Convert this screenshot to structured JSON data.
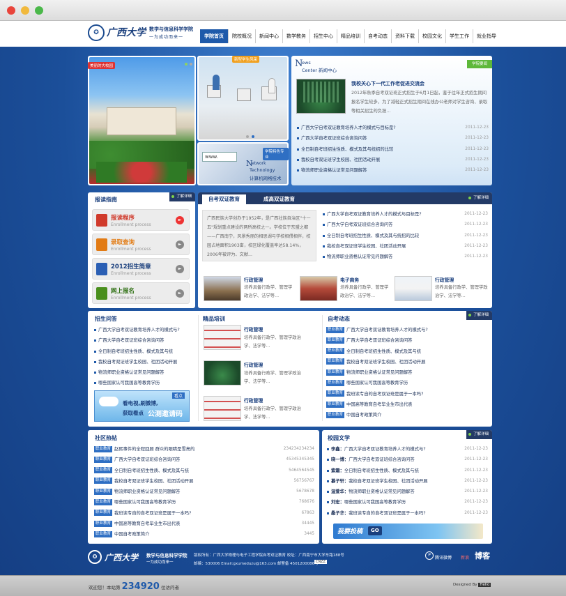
{
  "header": {
    "school_name": "广西大学",
    "school_dept": "数学与信息科学学院",
    "slogan": "一为成功而来一"
  },
  "nav": {
    "items": [
      "学院首页",
      "院校概况",
      "新闻中心",
      "数学教务",
      "招生中心",
      "精品培训",
      "自考动态",
      "资料下载",
      "校园文化",
      "学生工作",
      "就业指导"
    ]
  },
  "banner": {
    "photo_tag": "美丽的大校园",
    "class_tag": "新型学生风采",
    "tech_tag": "学院特色专业",
    "tech_caption_1": "etwork",
    "tech_caption_2": "Technology",
    "tech_caption_3": "计算机网络技术",
    "www_label": "www."
  },
  "news": {
    "title_en_1": "ews",
    "title_en_2": "Center 新闻中心",
    "badge": "学院要闻",
    "feature_title": "我校关心下一代工作老促进交流会",
    "feature_text": "2012年秋季自考双证班正式招生于6月1日起，鉴于往年正式招生期间报名学生较多，为了减轻正式招生期间在线办公老师对学生咨询、录取等相关招生的负担...",
    "items": [
      {
        "text": "广西大学自考双证教育培养人才的模式与目标是?",
        "date": "2011-12-23"
      },
      {
        "text": "广西大学自考双证班综合咨询问答",
        "date": "2011-12-23"
      },
      {
        "text": "全日制自考班招生性质、模式及其与统招的比较",
        "date": "2011-12-23"
      },
      {
        "text": "我校自考双证班学生校园、社团活动开展",
        "date": "2011-12-23"
      },
      {
        "text": "物流师职业资格认证常见问题解答",
        "date": "2011-12-23"
      }
    ]
  },
  "guide": {
    "title": "报读指南",
    "more": "了解详细",
    "entries": [
      {
        "label": "报读程序",
        "sub": "Enrollment process",
        "color": "#d03a2b"
      },
      {
        "label": "录取查询",
        "sub": "Enrollment process",
        "color": "#e27b14"
      },
      {
        "label": "2012招生简章",
        "sub": "Enrollment process",
        "color": "#2b5fb4"
      },
      {
        "label": "网上报名",
        "sub": "Enrollment process",
        "color": "#4a8f1d"
      }
    ]
  },
  "edu": {
    "tab_active": "自考双证教育",
    "tab_other": "成高双证教育",
    "more": "了解详细",
    "intro": "广西民族大学创办于1952年，是广西壮族自治区\"十一五\"规划重点建设的两所高校之一。学校位于东盟之都——广西南宁，风景秀丽的相思湖与学校相偎相伴，校园占地面积1903亩，校区绿化覆盖率达58.14%，2006年被评为、文献...",
    "items": [
      {
        "text": "广西大学自考双证教育培养人才的模式与目标是?",
        "date": "2011-12-23"
      },
      {
        "text": "广西大学自考双证班综合咨询问答",
        "date": "2011-12-23"
      },
      {
        "text": "全日制自考班招生性质、模式及其与统招的比较",
        "date": "2011-12-23"
      },
      {
        "text": "我校自考双证班学生校园、社团活动开展",
        "date": "2011-12-23"
      },
      {
        "text": "物流师职业资格认证常见问题解答",
        "date": "2011-12-23"
      }
    ],
    "courses": [
      {
        "title": "行政管理",
        "desc": "培养具备行政学、管理学政治学、法学等..."
      },
      {
        "title": "电子商务",
        "desc": "培养具备行政学、管理学政治学、法学等..."
      },
      {
        "title": "行政管理",
        "desc": "培养具备行政学、管理学政治学、法学等..."
      }
    ]
  },
  "qa": {
    "title": "招生问答",
    "items": [
      "广西大学自考双证教育培养人才的模式与?",
      "广西大学自考双证班综合咨询问答",
      "全日制自考班招生性质、模式及其与统",
      "我校自考双证班学生校园、社团活动开展",
      "物流师职业资格认证常见问题解答",
      "哪些国家认可我国高等教育学历"
    ],
    "ad_line1": "看电视,刷微博,",
    "ad_line2": "获取看点",
    "ad_line3": "公测邀请码",
    "ad_logo": "看点"
  },
  "training": {
    "title": "精品培训",
    "items": [
      {
        "title": "行政管理",
        "desc": "培养具备行政学、管理学政治学、法学等..."
      },
      {
        "title": "行政管理",
        "desc": "培养具备行政学、管理学政治学、法学等..."
      },
      {
        "title": "行政管理",
        "desc": "培养具备行政学、管理学政治学、法学等..."
      }
    ]
  },
  "dynamics": {
    "title": "自考动态",
    "more": "了解详细",
    "tag": "职业教育",
    "items": [
      "广西大学自考双证教育培养人才的模式与?",
      "广西大学自考双证班综合咨询问答",
      "全日制自考班招生性质、模式及其与统",
      "我校自考双证班学生校园、社团活动开展",
      "物流师职业资格认证常见问题解答",
      "哪些国家认可我国高等教育学历",
      "我班读专自的自考双证班是属于一本吗?",
      "中国高等教育自考毕业生市出代表",
      "中国自考政策简介"
    ]
  },
  "community": {
    "title": "社区热帖",
    "tag": "职业教育",
    "items": [
      {
        "text": "赵熙事件的全程回顾 群众的眼睛是雪亮的",
        "num": "234234234234"
      },
      {
        "text": "广西大学自考双证班综合咨询问答",
        "num": "45345345345"
      },
      {
        "text": "全日制自考班招生性质、模式及其与统",
        "num": "5464564545"
      },
      {
        "text": "我校自考双证班学生校园、社团活动开展",
        "num": "56756767"
      },
      {
        "text": "物流师职业资格认证常见问题解答",
        "num": "5678678"
      },
      {
        "text": "哪些国家认可我国高等教育学历",
        "num": "768676"
      },
      {
        "text": "我班读专自的自考双证班是属于一本吗?",
        "num": "67863"
      },
      {
        "text": "中国高等教育自考毕业生市出代表",
        "num": "34445"
      },
      {
        "text": "中国自考政策简介",
        "num": "3445"
      }
    ]
  },
  "campus": {
    "title": "校园文学",
    "more": "了解详细",
    "items": [
      {
        "author": "李鑫：",
        "text": "广西大学自考双证教育培养人才的模式与?",
        "date": "2011-12-23"
      },
      {
        "author": "晓一博：",
        "text": "广西大学自考双证班综合咨询问答",
        "date": "2011-12-23"
      },
      {
        "author": "紫霜：",
        "text": "全日制自考班招生性质、模式及其与统",
        "date": "2011-12-23"
      },
      {
        "author": "慕子轩：",
        "text": "我校自考双证班学生校园、社团活动开展",
        "date": "2011-12-23"
      },
      {
        "author": "温萱华：",
        "text": "物流师职业资格认证常见问题解答",
        "date": "2011-12-23"
      },
      {
        "author": "刘宏：",
        "text": "哪些国家认可我国高等教育学历",
        "date": "2011-12-23"
      },
      {
        "author": "桑子华：",
        "text": "我班读专自的自考双证班是属于一本吗?",
        "date": "2011-12-23"
      }
    ],
    "submit_label": "我要投稿",
    "submit_go": "GO"
  },
  "footer": {
    "school_name": "广西大学",
    "dept": "数学与信息科学学院",
    "slogan": "一为成功而来一",
    "copyright": "版权所有：广西大学物理与电子工程学院自考双证教育   校址：广西南宁市大学东路188号",
    "contact": "邮编：530006 Email:gxumeduzu@163.com  邮警备 4501200086号",
    "cnzz": "CNZZ",
    "weibo_label": "腾讯微博",
    "sina_label": "新浪",
    "blog_label": "博客"
  },
  "bottom": {
    "visitor_prefix": "欢迎您！本站第",
    "visitor_count": "234920",
    "visitor_suffix": "位访问者",
    "designed_by": "Designed By",
    "designer": "Hello"
  },
  "colors": {
    "brand": "#1f5aaa",
    "accent_green": "#7fd34a",
    "dark_tab": "#233a66",
    "hot_red": "#e33333"
  }
}
